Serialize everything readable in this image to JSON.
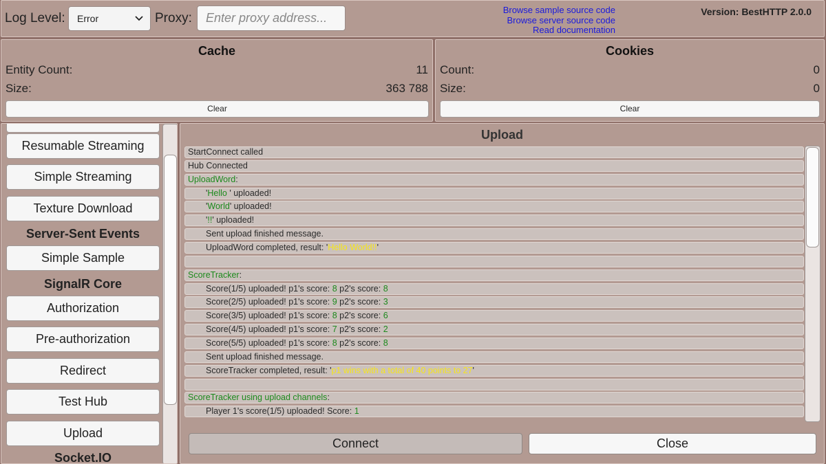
{
  "topbar": {
    "log_level_label": "Log Level:",
    "log_level_value": "Error",
    "proxy_label": "Proxy:",
    "proxy_placeholder": "Enter proxy address...",
    "links": [
      "Browse sample source code",
      "Browse server source code",
      "Read documentation"
    ],
    "version": "Version: BestHTTP 2.0.0"
  },
  "cache": {
    "title": "Cache",
    "entity_count_label": "Entity Count:",
    "entity_count_value": "11",
    "size_label": "Size:",
    "size_value": "363 788",
    "clear_label": "Clear"
  },
  "cookies": {
    "title": "Cookies",
    "count_label": "Count:",
    "count_value": "0",
    "size_label": "Size:",
    "size_value": "0",
    "clear_label": "Clear"
  },
  "sidebar": {
    "resumable_streaming": "Resumable Streaming",
    "simple_streaming": "Simple Streaming",
    "texture_download": "Texture Download",
    "sse_header": "Server-Sent Events",
    "simple_sample": "Simple Sample",
    "signalr_header": "SignalR Core",
    "authorization": "Authorization",
    "pre_authorization": "Pre-authorization",
    "redirect": "Redirect",
    "test_hub": "Test Hub",
    "upload": "Upload",
    "socketio_header": "Socket.IO"
  },
  "upload": {
    "title": "Upload",
    "log": [
      {
        "segments": [
          {
            "t": "StartConnect called"
          }
        ]
      },
      {
        "segments": [
          {
            "t": "Hub Connected"
          }
        ]
      },
      {
        "segments": [
          {
            "t": "UploadWord",
            "c": "g"
          },
          {
            "t": ":"
          }
        ]
      },
      {
        "indent": true,
        "segments": [
          {
            "t": "'"
          },
          {
            "t": "Hello ",
            "c": "g"
          },
          {
            "t": "' uploaded!"
          }
        ]
      },
      {
        "indent": true,
        "segments": [
          {
            "t": "'"
          },
          {
            "t": "World",
            "c": "g"
          },
          {
            "t": "' uploaded!"
          }
        ]
      },
      {
        "indent": true,
        "segments": [
          {
            "t": "'"
          },
          {
            "t": "!!",
            "c": "g"
          },
          {
            "t": "' uploaded!"
          }
        ]
      },
      {
        "indent": true,
        "segments": [
          {
            "t": "Sent upload finished message."
          }
        ]
      },
      {
        "indent": true,
        "segments": [
          {
            "t": "UploadWord completed, result: '"
          },
          {
            "t": "Hello World!!",
            "c": "y"
          },
          {
            "t": "'"
          }
        ]
      },
      {
        "segments": []
      },
      {
        "segments": [
          {
            "t": "ScoreTracker",
            "c": "g"
          },
          {
            "t": ":"
          }
        ]
      },
      {
        "indent": true,
        "segments": [
          {
            "t": "Score(1/5) uploaded! p1's score: "
          },
          {
            "t": "8",
            "c": "g"
          },
          {
            "t": " p2's score: "
          },
          {
            "t": "8",
            "c": "g"
          }
        ]
      },
      {
        "indent": true,
        "segments": [
          {
            "t": "Score(2/5) uploaded! p1's score: "
          },
          {
            "t": "9",
            "c": "g"
          },
          {
            "t": " p2's score: "
          },
          {
            "t": "3",
            "c": "g"
          }
        ]
      },
      {
        "indent": true,
        "segments": [
          {
            "t": "Score(3/5) uploaded! p1's score: "
          },
          {
            "t": "8",
            "c": "g"
          },
          {
            "t": " p2's score: "
          },
          {
            "t": "6",
            "c": "g"
          }
        ]
      },
      {
        "indent": true,
        "segments": [
          {
            "t": "Score(4/5) uploaded! p1's score: "
          },
          {
            "t": "7",
            "c": "g"
          },
          {
            "t": " p2's score: "
          },
          {
            "t": "2",
            "c": "g"
          }
        ]
      },
      {
        "indent": true,
        "segments": [
          {
            "t": "Score(5/5) uploaded! p1's score: "
          },
          {
            "t": "8",
            "c": "g"
          },
          {
            "t": " p2's score: "
          },
          {
            "t": "8",
            "c": "g"
          }
        ]
      },
      {
        "indent": true,
        "segments": [
          {
            "t": "Sent upload finished message."
          }
        ]
      },
      {
        "indent": true,
        "segments": [
          {
            "t": "ScoreTracker completed, result: '"
          },
          {
            "t": "p1 wins with a total of 40 points to 27",
            "c": "y"
          },
          {
            "t": "'"
          }
        ]
      },
      {
        "segments": []
      },
      {
        "segments": [
          {
            "t": "ScoreTracker using upload channels",
            "c": "g"
          },
          {
            "t": ":"
          }
        ]
      },
      {
        "indent": true,
        "segments": [
          {
            "t": "Player 1's score(1/5) uploaded! Score: "
          },
          {
            "t": "1",
            "c": "g"
          }
        ]
      }
    ],
    "connect_label": "Connect",
    "close_label": "Close"
  },
  "colors": {
    "background": "#8f6f68",
    "panel": "#b39a92",
    "log_row": "#cbc1bd",
    "highlight_green": "#1d8a1d",
    "highlight_yellow": "#f6e51a",
    "link_blue": "#1a1adc"
  }
}
